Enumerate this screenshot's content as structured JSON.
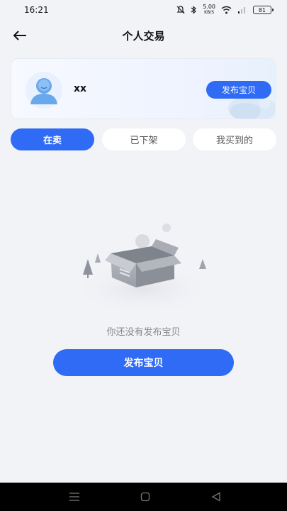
{
  "status_bar": {
    "time": "16:21",
    "net_speed_value": "5.00",
    "net_speed_unit": "KB/S",
    "battery": "81",
    "icons": [
      "mute-icon",
      "bluetooth-icon",
      "wifi-icon",
      "signal-icon",
      "battery-icon"
    ]
  },
  "header": {
    "title": "个人交易",
    "back_icon": "arrow-left-icon"
  },
  "profile": {
    "username": "xx",
    "publish_label": "发布宝贝"
  },
  "tabs": [
    {
      "label": "在卖",
      "active": true
    },
    {
      "label": "已下架",
      "active": false
    },
    {
      "label": "我买到的",
      "active": false
    }
  ],
  "empty_state": {
    "message": "你还没有发布宝贝",
    "button_label": "发布宝贝"
  },
  "colors": {
    "accent": "#2f6bf5",
    "background": "#f2f3f7"
  },
  "nav_bar": {
    "icons": [
      "menu-icon",
      "home-icon",
      "back-icon"
    ]
  }
}
